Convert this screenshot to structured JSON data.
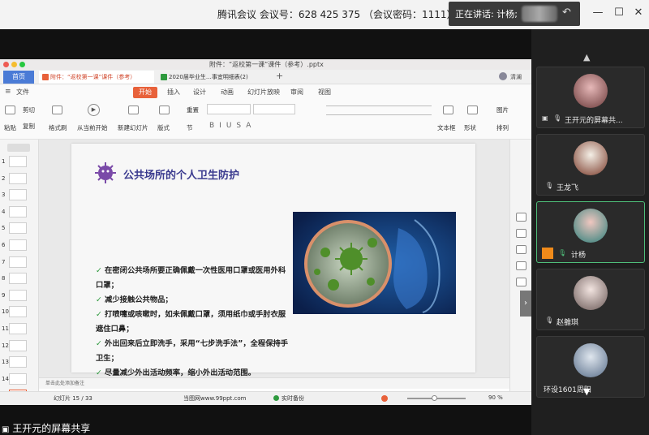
{
  "meeting": {
    "title": "腾讯会议 会议号：628 425 375 （会议密码：1111）",
    "speaking_label": "正在讲话: 计杨;",
    "minimize": "—",
    "restore": "☐",
    "close": "✕"
  },
  "wps": {
    "file_title": "附件：“返校第一课”课件（参考）.pptx",
    "home_tab": "首页",
    "doc_tabs": [
      "附件：“返校第一课”课件（参考）",
      "2020届毕业生…事宜明细表(2)"
    ],
    "add_tab": "+",
    "user_name": "清澜",
    "ribbon_tabs": [
      "文件",
      "开始",
      "插入",
      "设计",
      "动画",
      "幻灯片放映",
      "审阅",
      "视图"
    ],
    "ribbon": {
      "cut": "剪切",
      "paste": "粘贴",
      "copy": "复制",
      "format_painter": "格式刷",
      "play_from_current": "从当前开始",
      "new_slide": "新建幻灯片",
      "layout": "版式",
      "section": "节",
      "reset": "重置",
      "textbox": "文本框",
      "shape": "形状",
      "arrange": "排列",
      "picture": "图片"
    },
    "slide": {
      "title": "公共场所的个人卫生防护",
      "bullets": [
        "在密闭公共场所要正确佩戴一次性医用口罩或医用外科口罩；",
        "减少接触公共物品；",
        "打喷嚏或咳嗽时，如未佩戴口罩，须用纸巾或手肘衣服遮住口鼻；",
        "外出回来后立即洗手，采用“七步洗手法”，全程保持手卫生；",
        "尽量减少外出活动频率，缩小外出活动范围。"
      ],
      "check": "✓"
    },
    "thumb_numbers": [
      "1",
      "2",
      "3",
      "4",
      "5",
      "6",
      "7",
      "8",
      "9",
      "10",
      "11",
      "12",
      "13",
      "14",
      "15"
    ],
    "notes_placeholder": "单击此处添加备注",
    "status": {
      "slide_counter": "幻灯片 15 / 33",
      "watermark_site": "当图网www.99ppt.com",
      "backup": "实时备份",
      "zoom": "90 %"
    }
  },
  "participants": [
    {
      "name": "王开元的屏幕共...",
      "role": "sharing"
    },
    {
      "name": "王龙飞",
      "role": "member"
    },
    {
      "name": "计杨",
      "role": "speaking"
    },
    {
      "name": "赵雒琪",
      "role": "member"
    },
    {
      "name": "环设1601周阳",
      "role": "member"
    }
  ],
  "bottom_share_label": "王开元的屏幕共享",
  "colors": {
    "wps_accent": "#e8613a",
    "home_tab_blue": "#4a7bd6",
    "active_speaker": "#4fbf7a",
    "slide_title": "#3b3b8f",
    "check_green": "#2e9a3e"
  },
  "icons": [
    "scroll-up-icon",
    "scroll-down-icon",
    "mic-icon",
    "screen-share-icon",
    "chevron-right-icon"
  ]
}
